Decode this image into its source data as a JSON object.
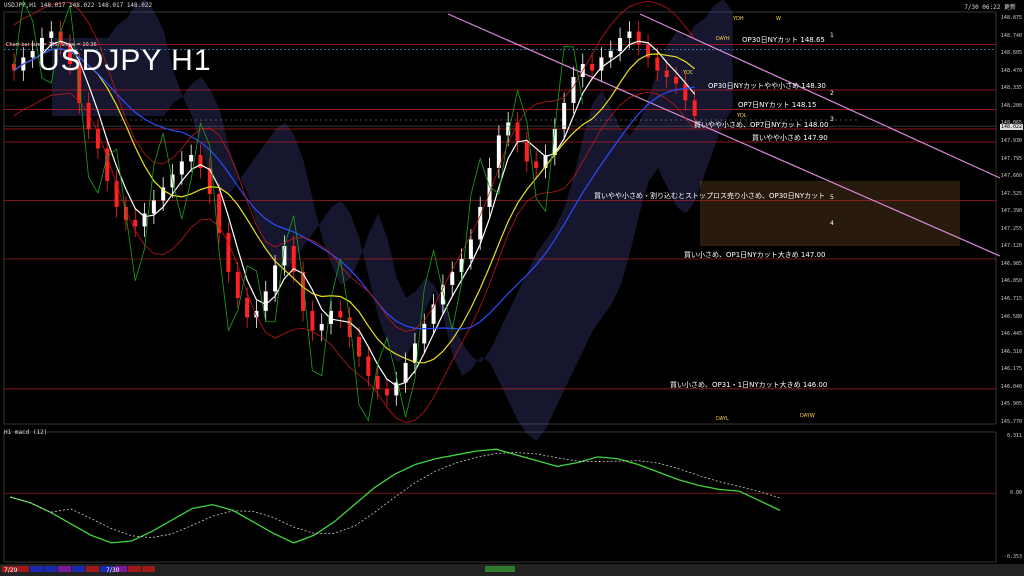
{
  "header": {
    "symbol_line": "USDJPY,H1  148.017 148.022 148.017 148.022",
    "title": "USDJPY H1",
    "datetime": "7/30 06:22 更新",
    "note": "Chart bar size = 755; Slope = 10.36"
  },
  "subwindow": {
    "title": "H1  macd (12)"
  },
  "price_axis": [
    "148.875",
    "148.740",
    "148.605",
    "148.470",
    "148.335",
    "148.200",
    "148.065",
    "147.930",
    "147.795",
    "147.660",
    "147.525",
    "147.390",
    "147.255",
    "147.120",
    "146.985",
    "146.850",
    "146.715",
    "146.580",
    "146.445",
    "146.310",
    "146.175",
    "146.040",
    "145.905",
    "145.770"
  ],
  "current_price": "148.022",
  "macd_axis": [
    "0.311",
    "0.00",
    "-0.353"
  ],
  "date_labels": [
    "7/29",
    "7/30"
  ],
  "level_labels": [
    {
      "text": "OP30日NYカット 148.65",
      "price": 148.65
    },
    {
      "text": "OP30日NYカットやや小さめ 148.30",
      "price": 148.3
    },
    {
      "text": "OP7日NYカット 148.15",
      "price": 148.15
    },
    {
      "text": "買いやや小さめ、OP7日NYカット 148.00",
      "price": 148.0
    },
    {
      "text": "買いやや小さめ 147.90",
      "price": 147.9
    },
    {
      "text": "買いやや小さめ・割り込むとストップロス売り小さめ、OP30日NYカット",
      "price": 147.45
    },
    {
      "text": "買い小さめ、OP1日NYカット大きめ 147.00",
      "price": 147.0
    },
    {
      "text": "買い小さめ、OP31・1日NYカット大きめ 146.00",
      "price": 146.0
    }
  ],
  "small_tags": [
    "YDH",
    "W",
    "DAYH",
    "YDC",
    "YDL",
    "DAYL",
    "DAYW"
  ],
  "line_numbers": [
    "1",
    "2",
    "3",
    "4",
    "5"
  ],
  "chart_data": {
    "type": "candlestick",
    "title": "USDJPY H1",
    "ylim": [
      145.73,
      148.9
    ],
    "horizontal_levels": [
      148.65,
      148.3,
      148.15,
      148.0,
      147.9,
      147.45,
      147.0,
      146.0
    ],
    "closes": [
      148.45,
      148.55,
      148.6,
      148.7,
      148.75,
      148.65,
      148.5,
      148.2,
      148.0,
      147.85,
      147.6,
      147.4,
      147.3,
      147.25,
      147.35,
      147.45,
      147.55,
      147.65,
      147.75,
      147.8,
      147.7,
      147.5,
      147.2,
      146.9,
      146.7,
      146.55,
      146.6,
      146.75,
      146.95,
      147.1,
      146.9,
      146.6,
      146.45,
      146.5,
      146.6,
      146.55,
      146.4,
      146.25,
      146.1,
      146.0,
      145.95,
      146.05,
      146.2,
      146.35,
      146.5,
      146.65,
      146.8,
      146.9,
      147.0,
      147.15,
      147.4,
      147.7,
      147.95,
      148.05,
      147.9,
      147.75,
      147.7,
      147.8,
      148.0,
      148.2,
      148.4,
      148.5,
      148.45,
      148.55,
      148.6,
      148.7,
      148.75,
      148.65,
      148.55,
      148.45,
      148.4,
      148.35,
      148.22,
      148.1
    ],
    "macd": [
      -0.02,
      -0.05,
      -0.1,
      -0.16,
      -0.22,
      -0.26,
      -0.25,
      -0.2,
      -0.14,
      -0.08,
      -0.06,
      -0.09,
      -0.15,
      -0.21,
      -0.26,
      -0.22,
      -0.15,
      -0.06,
      0.03,
      0.1,
      0.15,
      0.18,
      0.2,
      0.22,
      0.23,
      0.2,
      0.17,
      0.14,
      0.16,
      0.19,
      0.18,
      0.15,
      0.11,
      0.07,
      0.04,
      0.02,
      0.01,
      -0.04,
      -0.09
    ]
  }
}
